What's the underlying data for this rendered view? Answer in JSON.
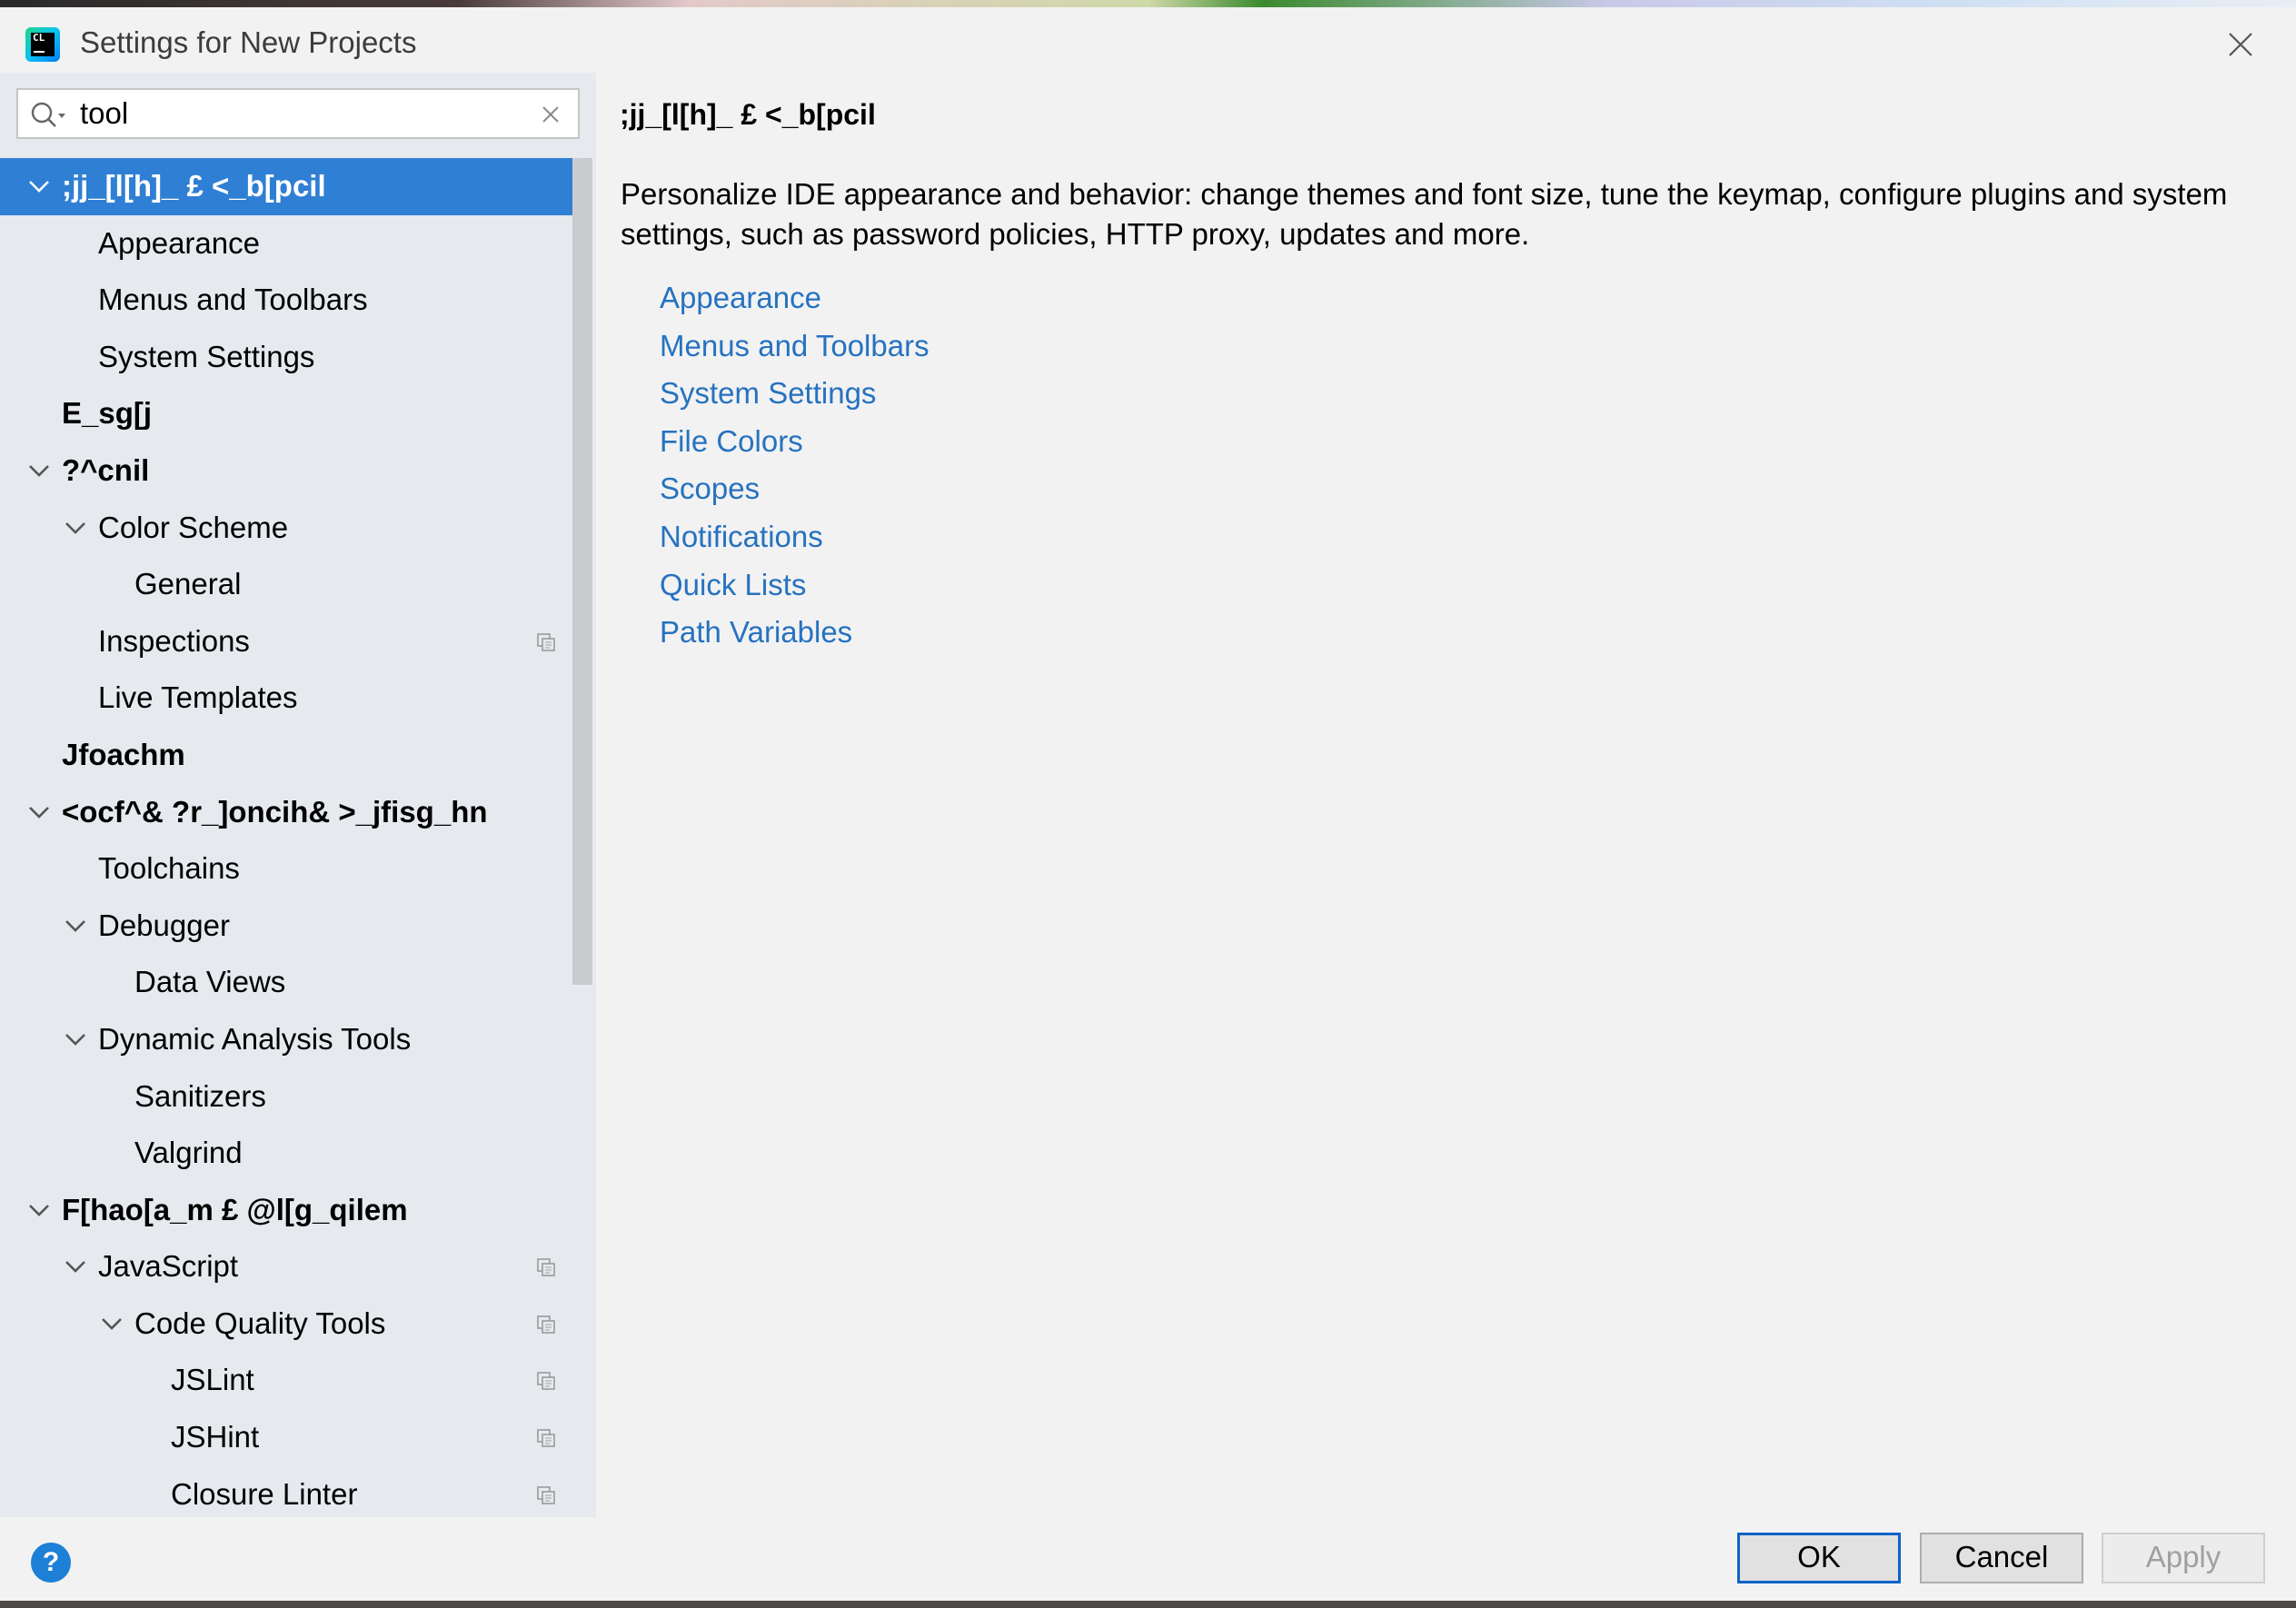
{
  "window": {
    "title": "Settings for New Projects",
    "app_icon_text": "CL"
  },
  "search": {
    "value": "tool"
  },
  "tree": [
    {
      "label": ";jj_[l[h]_ £ <_b[pcil",
      "level": 0,
      "expanded": true,
      "bold": true,
      "selected": true,
      "copy": false,
      "name": "tree-item-appearance-behavior"
    },
    {
      "label": "Appearance",
      "level": 1,
      "expanded": null,
      "bold": false,
      "selected": false,
      "copy": false,
      "name": "tree-item-appearance"
    },
    {
      "label": "Menus and Toolbars",
      "level": 1,
      "expanded": null,
      "bold": false,
      "selected": false,
      "copy": false,
      "name": "tree-item-menus-toolbars"
    },
    {
      "label": "System Settings",
      "level": 1,
      "expanded": null,
      "bold": false,
      "selected": false,
      "copy": false,
      "name": "tree-item-system-settings"
    },
    {
      "label": "E_sg[j",
      "level": 0,
      "expanded": null,
      "bold": true,
      "selected": false,
      "copy": false,
      "name": "tree-item-keymap"
    },
    {
      "label": "?^cnil",
      "level": 0,
      "expanded": true,
      "bold": true,
      "selected": false,
      "copy": false,
      "name": "tree-item-editor"
    },
    {
      "label": "Color Scheme",
      "level": 1,
      "expanded": true,
      "bold": false,
      "selected": false,
      "copy": false,
      "name": "tree-item-color-scheme"
    },
    {
      "label": "General",
      "level": 2,
      "expanded": null,
      "bold": false,
      "selected": false,
      "copy": false,
      "name": "tree-item-general"
    },
    {
      "label": "Inspections",
      "level": 1,
      "expanded": null,
      "bold": false,
      "selected": false,
      "copy": true,
      "name": "tree-item-inspections"
    },
    {
      "label": "Live Templates",
      "level": 1,
      "expanded": null,
      "bold": false,
      "selected": false,
      "copy": false,
      "name": "tree-item-live-templates"
    },
    {
      "label": "Jfoachm",
      "level": 0,
      "expanded": null,
      "bold": true,
      "selected": false,
      "copy": false,
      "name": "tree-item-plugins"
    },
    {
      "label": "<ocf^& ?r_]oncih& >_jfisg_hn",
      "level": 0,
      "expanded": true,
      "bold": true,
      "selected": false,
      "copy": false,
      "name": "tree-item-build-execution-deployment"
    },
    {
      "label": "Toolchains",
      "level": 1,
      "expanded": null,
      "bold": false,
      "selected": false,
      "copy": false,
      "name": "tree-item-toolchains"
    },
    {
      "label": "Debugger",
      "level": 1,
      "expanded": true,
      "bold": false,
      "selected": false,
      "copy": false,
      "name": "tree-item-debugger"
    },
    {
      "label": "Data Views",
      "level": 2,
      "expanded": null,
      "bold": false,
      "selected": false,
      "copy": false,
      "name": "tree-item-data-views"
    },
    {
      "label": "Dynamic Analysis Tools",
      "level": 1,
      "expanded": true,
      "bold": false,
      "selected": false,
      "copy": false,
      "name": "tree-item-dynamic-analysis-tools"
    },
    {
      "label": "Sanitizers",
      "level": 2,
      "expanded": null,
      "bold": false,
      "selected": false,
      "copy": false,
      "name": "tree-item-sanitizers"
    },
    {
      "label": "Valgrind",
      "level": 2,
      "expanded": null,
      "bold": false,
      "selected": false,
      "copy": false,
      "name": "tree-item-valgrind"
    },
    {
      "label": "F[hao[a_m £ @l[g_qilem",
      "level": 0,
      "expanded": true,
      "bold": true,
      "selected": false,
      "copy": false,
      "name": "tree-item-languages-frameworks"
    },
    {
      "label": "JavaScript",
      "level": 1,
      "expanded": true,
      "bold": false,
      "selected": false,
      "copy": true,
      "name": "tree-item-javascript"
    },
    {
      "label": "Code Quality Tools",
      "level": 2,
      "expanded": true,
      "bold": false,
      "selected": false,
      "copy": true,
      "name": "tree-item-code-quality-tools"
    },
    {
      "label": "JSLint",
      "level": 3,
      "expanded": null,
      "bold": false,
      "selected": false,
      "copy": true,
      "name": "tree-item-jslint"
    },
    {
      "label": "JSHint",
      "level": 3,
      "expanded": null,
      "bold": false,
      "selected": false,
      "copy": true,
      "name": "tree-item-jshint"
    },
    {
      "label": "Closure Linter",
      "level": 3,
      "expanded": null,
      "bold": false,
      "selected": false,
      "copy": true,
      "name": "tree-item-closure-linter"
    }
  ],
  "content": {
    "heading": ";jj_[l[h]_ £ <_b[pcil",
    "description": "Personalize IDE appearance and behavior: change themes and font size, tune the keymap, configure plugins and system settings, such as password policies, HTTP proxy, updates and more.",
    "links": [
      "Appearance",
      "Menus and Toolbars",
      "System Settings",
      "File Colors",
      "Scopes",
      "Notifications",
      "Quick Lists",
      "Path Variables"
    ]
  },
  "buttons": {
    "ok": "OK",
    "cancel": "Cancel",
    "apply": "Apply",
    "help": "?"
  },
  "colors": {
    "selection": "#2f7fd4",
    "link": "#2672c0",
    "sidebar_bg": "#e6e9ee",
    "dialog_bg": "#f2f2f2",
    "ok_border": "#0a63c8"
  },
  "icons": {
    "search": "search-icon",
    "close": "close-icon",
    "clear": "clear-search-icon",
    "chevron": "chevron-down-icon",
    "copy": "copy-settings-icon",
    "help": "help-icon"
  }
}
